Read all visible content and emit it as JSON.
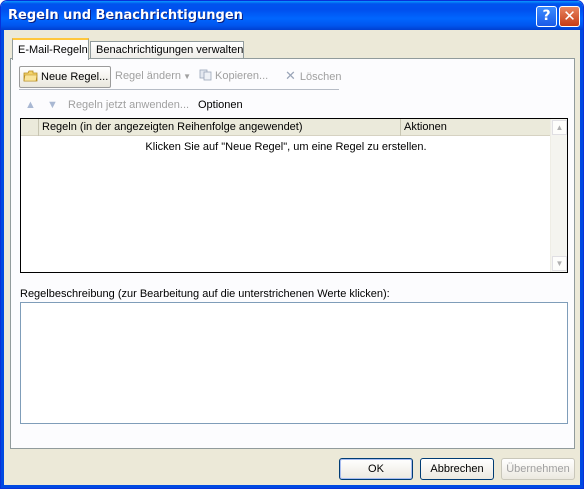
{
  "window": {
    "title": "Regeln und Benachrichtigungen",
    "help_glyph": "?",
    "close_glyph": "✕"
  },
  "tabs": [
    {
      "label": "E-Mail-Regeln",
      "active": true
    },
    {
      "label": "Benachrichtigungen verwalten",
      "active": false
    }
  ],
  "toolbar": {
    "new_rule": "Neue Regel...",
    "change_rule": "Regel ändern",
    "copy": "Kopieren...",
    "delete": "Löschen"
  },
  "secondary": {
    "apply_now": "Regeln jetzt anwenden...",
    "options": "Optionen"
  },
  "list": {
    "columns": [
      "Regeln (in der angezeigten Reihenfolge angewendet)",
      "Aktionen"
    ],
    "empty_message": "Klicken Sie auf \"Neue Regel\", um eine Regel zu erstellen."
  },
  "description": {
    "label": "Regelbeschreibung (zur Bearbeitung auf die unterstrichenen Werte klicken):"
  },
  "buttons": {
    "ok": "OK",
    "cancel": "Abbrechen",
    "apply": "Übernehmen"
  },
  "colors": {
    "titlebar": "#0053ee",
    "dialog_bg": "#ece9d8",
    "tab_highlight": "#ffc73c"
  }
}
